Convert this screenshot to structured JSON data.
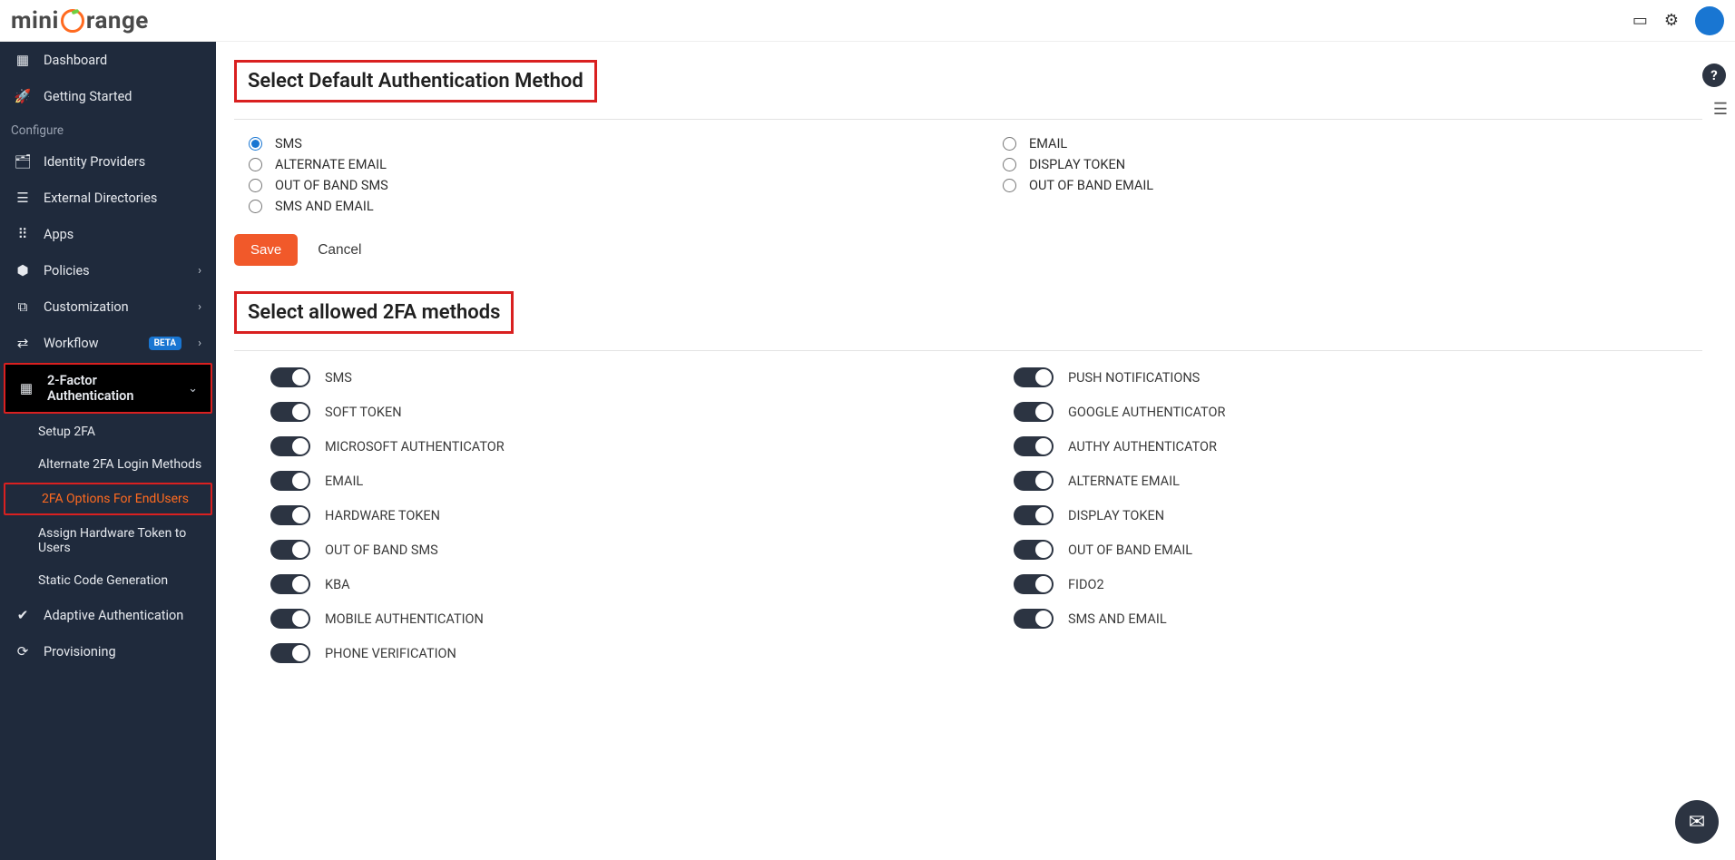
{
  "logo": {
    "prefix": "mini",
    "suffix": "range"
  },
  "sidebar": {
    "top": [
      {
        "icon": "▦",
        "label": "Dashboard"
      },
      {
        "icon": "🚀",
        "label": "Getting Started"
      }
    ],
    "section_label": "Configure",
    "config": [
      {
        "icon": "🗂",
        "label": "Identity Providers",
        "chev": ""
      },
      {
        "icon": "☰",
        "label": "External Directories",
        "chev": ""
      },
      {
        "icon": "⠿",
        "label": "Apps",
        "chev": ""
      },
      {
        "icon": "⬢",
        "label": "Policies",
        "chev": "›"
      },
      {
        "icon": "⧉",
        "label": "Customization",
        "chev": "›"
      },
      {
        "icon": "⇄",
        "label": "Workflow",
        "chev": "›",
        "beta": "BETA"
      }
    ],
    "active_parent": {
      "icon": "▦",
      "label": "2-Factor Authentication",
      "chev": "⌄"
    },
    "subs": [
      {
        "label": "Setup 2FA"
      },
      {
        "label": "Alternate 2FA Login Methods"
      },
      {
        "label": "2FA Options For EndUsers",
        "active": true
      },
      {
        "label": "Assign Hardware Token to Users"
      },
      {
        "label": "Static Code Generation"
      }
    ],
    "bottom": [
      {
        "icon": "✔",
        "label": "Adaptive Authentication"
      },
      {
        "icon": "⟳",
        "label": "Provisioning"
      }
    ]
  },
  "section1": {
    "title": "Select Default Authentication Method",
    "left": [
      {
        "label": "SMS",
        "checked": true
      },
      {
        "label": "ALTERNATE EMAIL"
      },
      {
        "label": "OUT OF BAND SMS"
      },
      {
        "label": "SMS AND EMAIL"
      }
    ],
    "right": [
      {
        "label": "EMAIL"
      },
      {
        "label": "DISPLAY TOKEN"
      },
      {
        "label": "OUT OF BAND EMAIL"
      }
    ],
    "save": "Save",
    "cancel": "Cancel"
  },
  "section2": {
    "title": "Select allowed 2FA methods",
    "left": [
      {
        "label": "SMS",
        "on": true
      },
      {
        "label": "SOFT TOKEN",
        "on": true
      },
      {
        "label": "MICROSOFT AUTHENTICATOR",
        "on": true
      },
      {
        "label": "EMAIL",
        "on": true
      },
      {
        "label": "HARDWARE TOKEN",
        "on": true
      },
      {
        "label": "OUT OF BAND SMS",
        "on": true
      },
      {
        "label": "KBA",
        "on": true
      },
      {
        "label": "MOBILE AUTHENTICATION",
        "on": true
      },
      {
        "label": "PHONE VERIFICATION",
        "on": true
      }
    ],
    "right": [
      {
        "label": "PUSH NOTIFICATIONS",
        "on": true
      },
      {
        "label": "GOOGLE AUTHENTICATOR",
        "on": true
      },
      {
        "label": "AUTHY AUTHENTICATOR",
        "on": true
      },
      {
        "label": "ALTERNATE EMAIL",
        "on": true
      },
      {
        "label": "DISPLAY TOKEN",
        "on": true
      },
      {
        "label": "OUT OF BAND EMAIL",
        "on": true
      },
      {
        "label": "FIDO2",
        "on": true
      },
      {
        "label": "SMS AND EMAIL",
        "on": true
      }
    ]
  }
}
